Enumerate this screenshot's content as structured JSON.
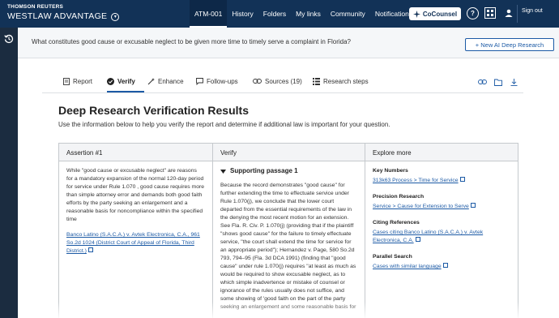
{
  "brand": {
    "top": "THOMSON REUTERS",
    "main": "WESTLAW ADVANTAGE"
  },
  "nav": {
    "items": [
      {
        "label": "ATM-001",
        "active": true
      },
      {
        "label": "History"
      },
      {
        "label": "Folders"
      },
      {
        "label": "My links"
      },
      {
        "label": "Community"
      },
      {
        "label": "Notifications"
      }
    ],
    "cocounsel": "CoCounsel",
    "help": "?",
    "signout": "Sign out"
  },
  "question": {
    "text": "What constitutes good cause or excusable neglect to be given more time to timely serve a complaint in Florida?",
    "new_button": "+ New AI Deep Research"
  },
  "tabs": [
    {
      "label": "Report",
      "icon": "document-icon"
    },
    {
      "label": "Verify",
      "icon": "check-circle-icon",
      "active": true
    },
    {
      "label": "Enhance",
      "icon": "wand-icon"
    },
    {
      "label": "Follow-ups",
      "icon": "chat-icon"
    },
    {
      "label": "Sources (19)",
      "icon": "link-icon"
    },
    {
      "label": "Research steps",
      "icon": "steps-icon"
    }
  ],
  "page": {
    "title": "Deep Research Verification Results",
    "subtitle": "Use the information below to help you verify the report and determine if additional law is important for your question."
  },
  "table": {
    "headers": {
      "assertion": "Assertion #1",
      "verify": "Verify",
      "explore": "Explore more"
    },
    "assertion": {
      "text": "While \"good cause or excusable neglect\" are reasons for a mandatory expansion of the normal 120-day period for service under Rule 1.070 , good cause requires more than simple attorney error and demands both good faith efforts by the party seeking an enlargement and a reasonable basis for noncompliance within the specified time",
      "citation": "Banco Latino (S.A.C.A.) v. Avtek Electronica, C.A., 961 So.2d 1024 (District Court of Appeal of Florida, Third District.)"
    },
    "verify": {
      "heading": "Supporting passage 1",
      "passage": "Because the record demonstrates \"good cause\" for further extending the time to effectuate service under Rule 1.070(j), we conclude that the lower court departed from the essential requirements of the law in the denying the most recent motion for an extension. See Fla. R. Civ. P. 1.070(j) (providing that if the plaintiff \"shows good cause\" for the failure to timely effectuate service, \"the court shall extend the time for service for an appropriate period\"); Hernandez v. Page, 580 So.2d 793, 794–95 (Fla. 3d DCA 1991) (finding that \"good cause\" under rule 1.070(j) requires \"at least as much as would be required to show excusable neglect, as to which simple inadvertence or mistake of counsel or ignorance of the rules usually does not suffice, and some showing of 'good faith on the part of the party seeking an enlargement and some reasonable basis for"
    },
    "explore": [
      {
        "label": "Key Numbers",
        "link": "313k63 Process > Time for Service"
      },
      {
        "label": "Precision Research",
        "link": "Service > Cause for Extension to Serve"
      },
      {
        "label": "Citing References",
        "link": "Cases citing Banco Latino (S.A.C.A.) v. Avtek Electronica, C.A."
      },
      {
        "label": "Parallel Search",
        "link": "Cases with similar language"
      }
    ]
  },
  "colors": {
    "navy": "#123257",
    "accent": "#1c5aa5",
    "sidebar": "#1b2c40"
  }
}
